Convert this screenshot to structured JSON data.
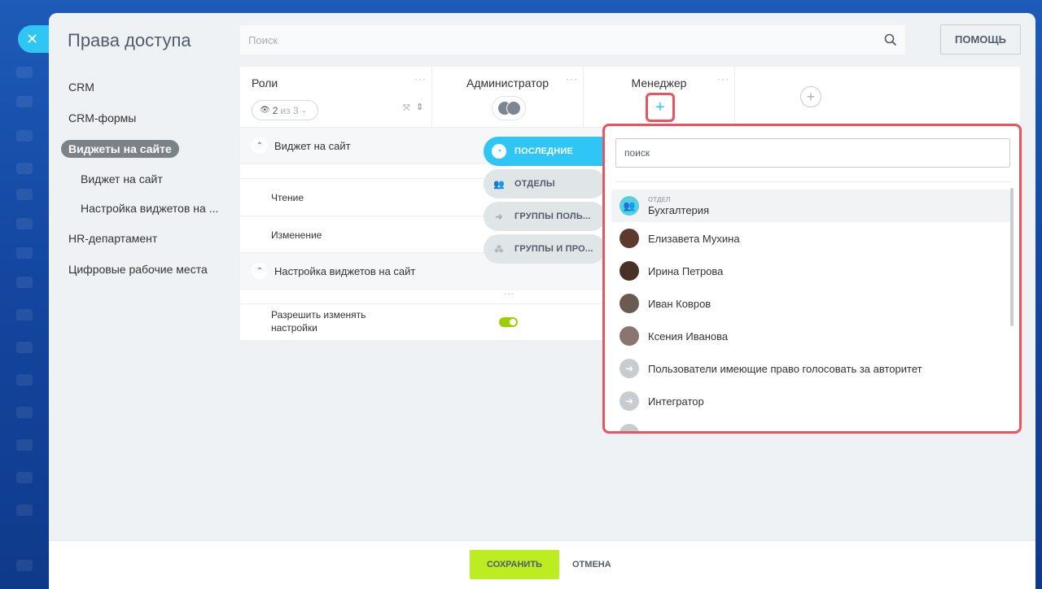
{
  "header": {
    "title": "Права доступа",
    "search_placeholder": "Поиск",
    "help_label": "ПОМОЩЬ"
  },
  "nav": {
    "items": [
      {
        "label": "CRM"
      },
      {
        "label": "CRM-формы"
      },
      {
        "label": "Виджеты на сайте",
        "active": true
      },
      {
        "label": "Виджет на сайт",
        "sub": true
      },
      {
        "label": "Настройка виджетов на ...",
        "sub": true
      },
      {
        "label": "HR-департамент"
      },
      {
        "label": "Цифровые рабочие места"
      }
    ]
  },
  "table": {
    "roles_title": "Роли",
    "count_value": "2",
    "count_of": "из 3",
    "columns": [
      {
        "title": "Администратор"
      },
      {
        "title": "Менеджер"
      }
    ],
    "sections": [
      {
        "label": "Виджет на сайт"
      },
      {
        "label": "Настройка виджетов на сайт"
      }
    ],
    "rows": [
      {
        "label": "Чтение"
      },
      {
        "label": "Изменение"
      },
      {
        "label": "Разрешить изменять настройки"
      }
    ]
  },
  "popup": {
    "tabs": [
      {
        "label": "ПОСЛЕДНИЕ",
        "active": true
      },
      {
        "label": "ОТДЕЛЫ"
      },
      {
        "label": "ГРУППЫ ПОЛЬ..."
      },
      {
        "label": "ГРУППЫ И ПРО..."
      }
    ],
    "search_placeholder": "поиск",
    "items": [
      {
        "tag": "ОТДЕЛ",
        "label": "Бухгалтерия",
        "type": "dept"
      },
      {
        "label": "Елизавета Мухина",
        "type": "person"
      },
      {
        "label": "Ирина Петрова",
        "type": "person"
      },
      {
        "label": "Иван Ковров",
        "type": "person"
      },
      {
        "label": "Ксения Иванова",
        "type": "person"
      },
      {
        "label": "Пользователи имеющие право голосовать за авторитет",
        "type": "group"
      },
      {
        "label": "Интегратор",
        "type": "group"
      }
    ]
  },
  "footer": {
    "save_label": "СОХРАНИТЬ",
    "cancel_label": "ОТМЕНА"
  },
  "colors": {
    "accent": "#2fc6f6",
    "save": "#bbed21",
    "highlight": "#e9545e",
    "toggle": "#9dcf00"
  }
}
